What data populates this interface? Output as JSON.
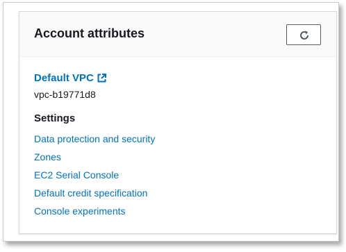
{
  "panel": {
    "title": "Account attributes",
    "refresh_icon": "refresh-icon"
  },
  "default_vpc": {
    "label": "Default VPC",
    "link_icon": "external-link-icon",
    "value": "vpc-b19771d8"
  },
  "settings": {
    "heading": "Settings",
    "items": [
      {
        "label": "Data protection and security"
      },
      {
        "label": "Zones"
      },
      {
        "label": "EC2 Serial Console"
      },
      {
        "label": "Default credit specification"
      },
      {
        "label": "Console experiments"
      }
    ]
  },
  "colors": {
    "link": "#0073bb",
    "text": "#16191f",
    "header_bg": "#fafafa"
  }
}
